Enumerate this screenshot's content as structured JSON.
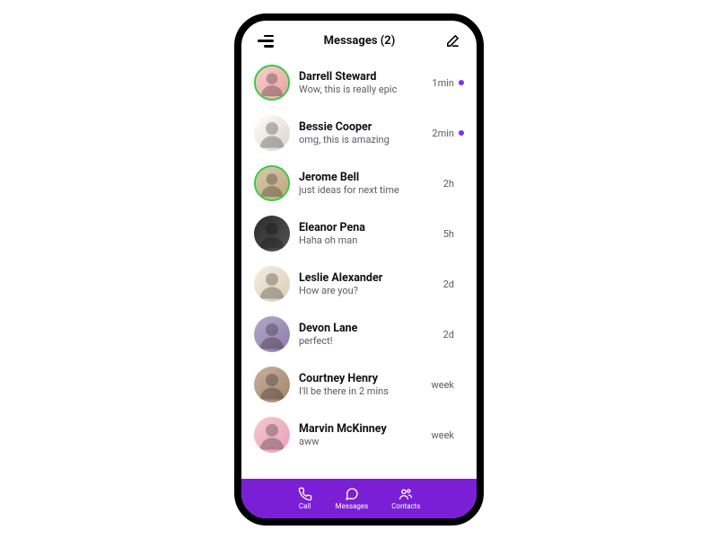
{
  "header": {
    "title": "Messages (2)"
  },
  "conversations": [
    {
      "name": "Darrell Steward",
      "preview": "Wow, this is really epic",
      "time": "1min",
      "unread": true,
      "online": true,
      "bg": "bg1"
    },
    {
      "name": "Bessie Cooper",
      "preview": "omg, this is amazing",
      "time": "2min",
      "unread": true,
      "online": false,
      "bg": "bg2"
    },
    {
      "name": "Jerome Bell",
      "preview": "just ideas for next time",
      "time": "2h",
      "unread": false,
      "online": true,
      "bg": "bg3"
    },
    {
      "name": "Eleanor Pena",
      "preview": "Haha oh man",
      "time": "5h",
      "unread": false,
      "online": false,
      "bg": "bg4"
    },
    {
      "name": "Leslie Alexander",
      "preview": "How are you?",
      "time": "2d",
      "unread": false,
      "online": false,
      "bg": "bg5"
    },
    {
      "name": "Devon Lane",
      "preview": "perfect!",
      "time": "2d",
      "unread": false,
      "online": false,
      "bg": "bg6"
    },
    {
      "name": "Courtney Henry",
      "preview": "I'll be there in 2 mins",
      "time": "week",
      "unread": false,
      "online": false,
      "bg": "bg7"
    },
    {
      "name": "Marvin McKinney",
      "preview": "aww",
      "time": "week",
      "unread": false,
      "online": false,
      "bg": "bg8"
    }
  ],
  "tabs": {
    "call": "Call",
    "messages": "Messages",
    "contacts": "Contacts"
  }
}
